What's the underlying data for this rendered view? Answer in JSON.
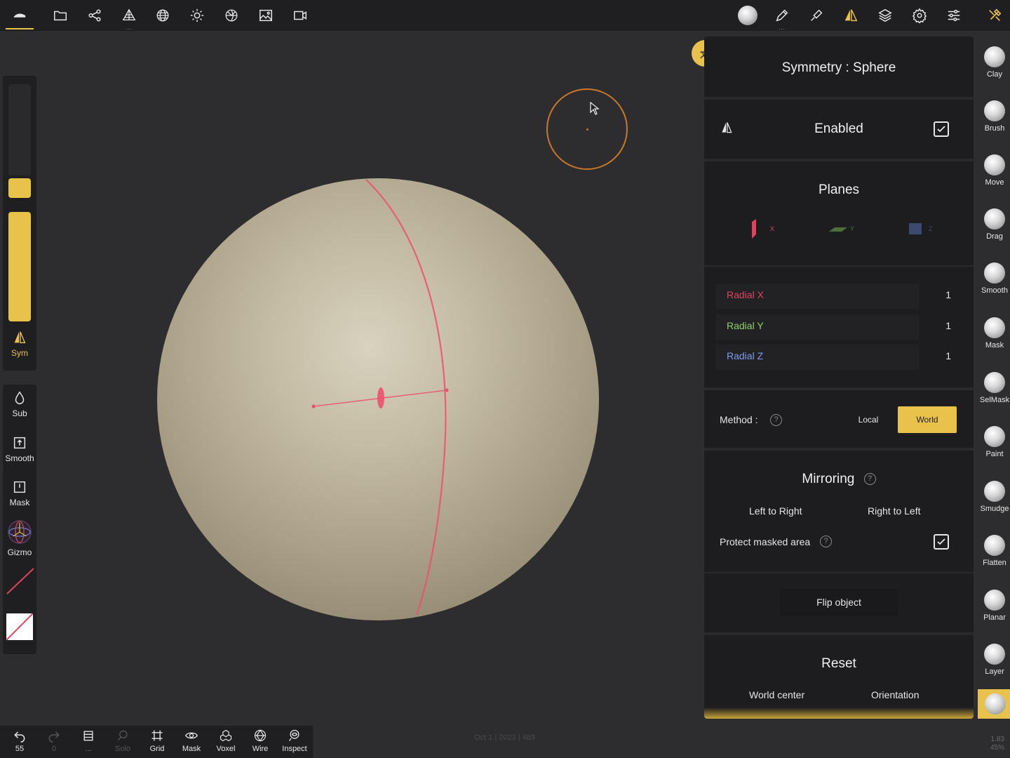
{
  "topbar": {
    "left_icons": [
      "scene-icon",
      "folder-icon",
      "share-icon",
      "topology-icon",
      "mesh-icon",
      "light-icon",
      "material-icon",
      "image-icon",
      "video-icon"
    ],
    "right_icons": [
      "matcap-icon",
      "pen-icon",
      "stroke-icon",
      "symmetry-icon",
      "layers-icon",
      "settings-icon",
      "sliders-icon",
      "tools-icon"
    ]
  },
  "left": {
    "sym_label": "Sym",
    "tools": [
      {
        "name": "sub",
        "label": "Sub"
      },
      {
        "name": "smooth",
        "label": "Smooth"
      },
      {
        "name": "mask",
        "label": "Mask"
      },
      {
        "name": "gizmo",
        "label": "Gizmo"
      }
    ]
  },
  "panel": {
    "title": "Symmetry : Sphere",
    "enabled_label": "Enabled",
    "enabled_checked": true,
    "planes_title": "Planes",
    "planes": [
      {
        "axis": "X",
        "color": "#e0445c"
      },
      {
        "axis": "Y",
        "color": "#4e6e3a"
      },
      {
        "axis": "Z",
        "color": "#3b4a6e"
      }
    ],
    "radial": [
      {
        "label": "Radial X",
        "value": "1",
        "color": "#e0445c"
      },
      {
        "label": "Radial Y",
        "value": "1",
        "color": "#8fd16a"
      },
      {
        "label": "Radial Z",
        "value": "1",
        "color": "#7f9bf0"
      }
    ],
    "method_label": "Method :",
    "method_options": [
      "Local",
      "World"
    ],
    "method_selected": "World",
    "mirroring_title": "Mirroring",
    "mirror_ltr": "Left to Right",
    "mirror_rtl": "Right to Left",
    "protect_label": "Protect masked area",
    "protect_checked": true,
    "flip_label": "Flip object",
    "reset_title": "Reset",
    "world_center": "World center",
    "orientation": "Orientation",
    "help_glyph": "?"
  },
  "brushes": [
    {
      "label": "Clay"
    },
    {
      "label": "Brush"
    },
    {
      "label": "Move"
    },
    {
      "label": "Drag"
    },
    {
      "label": "Smooth"
    },
    {
      "label": "Mask"
    },
    {
      "label": "SelMask"
    },
    {
      "label": "Paint"
    },
    {
      "label": "Smudge"
    },
    {
      "label": "Flatten"
    },
    {
      "label": "Planar"
    },
    {
      "label": "Layer"
    }
  ],
  "bottom": {
    "undo_count": "55",
    "redo_count": "0",
    "items": [
      {
        "name": "solo",
        "label": "Solo"
      },
      {
        "name": "grid",
        "label": "Grid"
      },
      {
        "name": "mask",
        "label": "Mask"
      },
      {
        "name": "voxel",
        "label": "Voxel"
      },
      {
        "name": "wire",
        "label": "Wire"
      },
      {
        "name": "inspect",
        "label": "Inspect"
      }
    ]
  },
  "footer_text": "Oct 1 | 2023 | 4b3",
  "stats": {
    "line1": "1.83",
    "line2": "45%"
  },
  "colors": {
    "accent": "#e8c24a",
    "panel_bg": "#1d1d1f",
    "viewport_bg": "#2d2d2f",
    "sym_line": "#ef4f6d"
  }
}
